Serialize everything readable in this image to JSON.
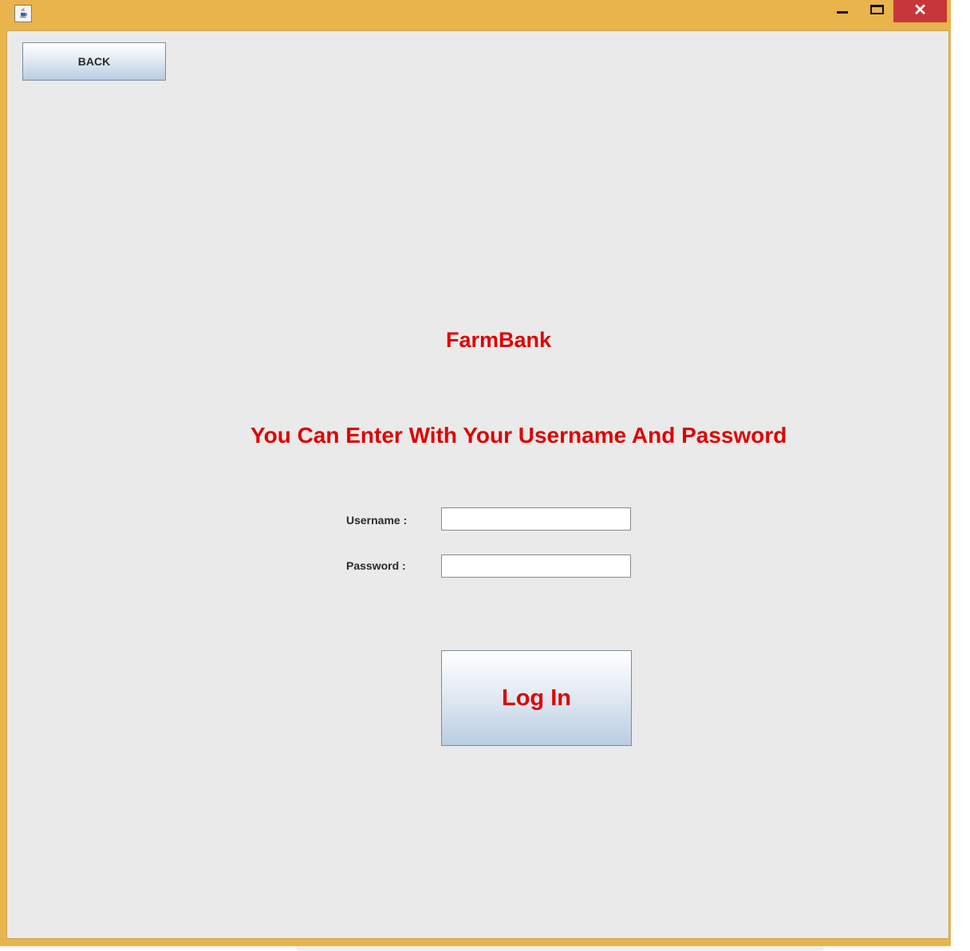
{
  "window": {
    "controls": {
      "close_glyph": "✕"
    },
    "icons": {
      "app": "java-coffee-cup-icon",
      "minimize": "minimize-icon",
      "maximize": "maximize-icon",
      "close": "close-icon"
    },
    "colors": {
      "frame": "#e9b44c",
      "close": "#c7363a",
      "content_bg": "#eaeaea"
    }
  },
  "toolbar": {
    "back_label": "BACK"
  },
  "login": {
    "brand": "FarmBank",
    "heading": "You Can Enter With Your Username And Password",
    "username_label": "Username :",
    "username_value": "",
    "password_label": "Password :",
    "password_value": "",
    "login_label": "Log In",
    "accent_color": "#e00000"
  }
}
